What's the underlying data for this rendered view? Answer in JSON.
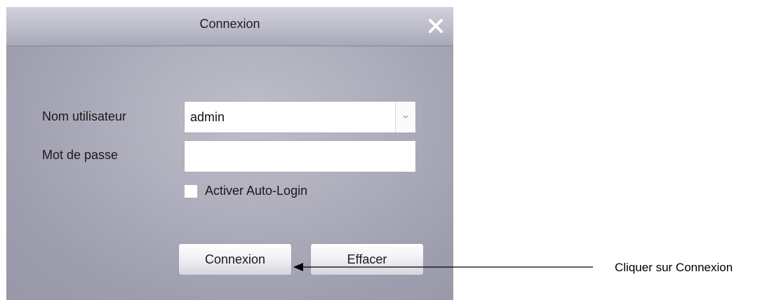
{
  "dialog": {
    "title": "Connexion",
    "close_icon": "close-icon",
    "username_label": "Nom utilisateur",
    "username_value": "admin",
    "password_label": "Mot de passe",
    "password_value": "",
    "auto_login_label": "Activer Auto-Login",
    "auto_login_checked": false,
    "connect_button": "Connexion",
    "clear_button": "Effacer"
  },
  "annotation": {
    "text": "Cliquer sur Connexion"
  }
}
